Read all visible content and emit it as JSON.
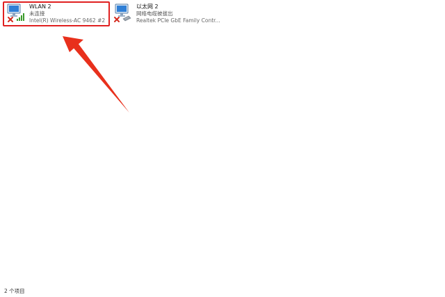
{
  "adapters": [
    {
      "name": "WLAN 2",
      "status": "未连接",
      "device": "Intel(R) Wireless-AC 9462 #2",
      "icon": "wifi-adapter-disconnected-icon"
    },
    {
      "name": "以太网 2",
      "status": "网络电缆被拔出",
      "device": "Realtek PCIe GbE Family Contr...",
      "icon": "ethernet-adapter-unplugged-icon"
    }
  ],
  "status_bar": {
    "item_count": "2 个项目"
  },
  "colors": {
    "highlight": "#e02020",
    "arrow": "#e8301c",
    "error_x": "#d42a1e",
    "signal": "#3a9a2a",
    "monitor": "#2f7fd6"
  }
}
